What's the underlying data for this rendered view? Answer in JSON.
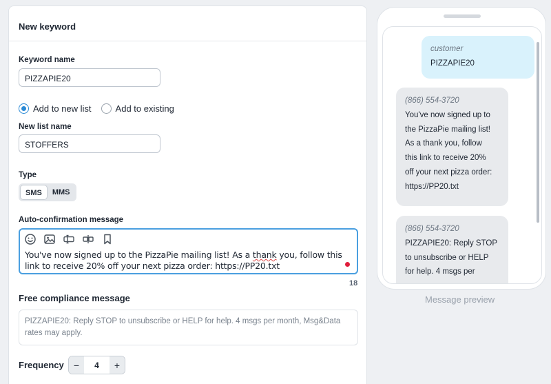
{
  "form": {
    "header_title": "New keyword",
    "keyword_name_label": "Keyword name",
    "keyword_name_value": "PIZZAPIE20",
    "radio_options": [
      {
        "label": "Add to new list",
        "checked": true
      },
      {
        "label": "Add to existing",
        "checked": false
      }
    ],
    "new_list_name_label": "New list name",
    "new_list_name_value": "STOFFERS",
    "type_label": "Type",
    "type_options": [
      "SMS",
      "MMS"
    ],
    "type_selected": "SMS",
    "auto_confirm_label": "Auto-confirmation message",
    "toolbar_icons": [
      "emoji-icon",
      "image-icon",
      "insert-field-icon",
      "insert-link-icon",
      "bookmark-icon"
    ],
    "message_before": "You've now signed up to the PizzaPie mailing list! As a ",
    "message_misspelled": "thank",
    "message_after": " you, follow this link to receive 20% off your next pizza order: https://PP20.txt",
    "char_count": "18",
    "compliance_title": "Free compliance message",
    "compliance_text": "PIZZAPIE20: Reply STOP to unsubscribe or HELP for help. 4 msgs per month, Msg&Data rates may apply.",
    "frequency_label": "Frequency",
    "frequency_minus": "−",
    "frequency_value": "4",
    "frequency_plus": "+"
  },
  "preview": {
    "label": "Message preview",
    "messages": [
      {
        "sender": "customer",
        "lines": [
          "PIZZAPIE20"
        ]
      },
      {
        "sender": "(866) 554-3720",
        "lines": [
          "You've now signed up to",
          "the PizzaPie mailing list!",
          "As a thank you, follow",
          "this link to receive 20%",
          "off your next pizza order:",
          "https://PP20.txt"
        ]
      },
      {
        "sender": "(866) 554-3720",
        "lines": [
          "PIZZAPIE20: Reply STOP",
          "to unsubscribe or HELP",
          "for help. 4 msgs per"
        ]
      }
    ]
  },
  "colors": {
    "accent": "#2b8ad6",
    "editor_focus": "#4a9fe0",
    "customer_bubble": "#d9f2fc",
    "business_bubble": "#e8eaed",
    "alert_dot": "#e01e3c"
  }
}
